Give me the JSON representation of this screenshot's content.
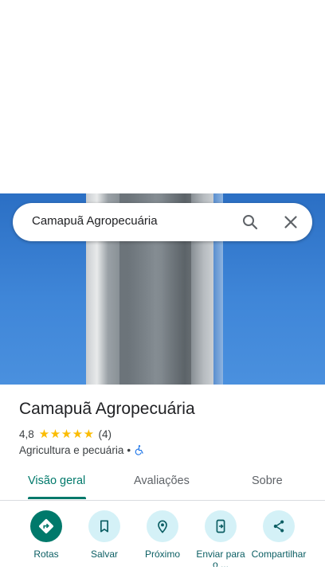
{
  "search": {
    "query": "Camapuã Agropecuária"
  },
  "place": {
    "name": "Camapuã Agropecuária",
    "rating": "4,8",
    "stars": [
      "★",
      "★",
      "★",
      "★",
      "★"
    ],
    "review_count": "(4)",
    "category": "Agricultura e pecuária",
    "separator": "•"
  },
  "tabs": [
    {
      "label": "Visão geral"
    },
    {
      "label": "Avaliações"
    },
    {
      "label": "Sobre"
    }
  ],
  "actions": [
    {
      "label": "Rotas",
      "icon": "directions-icon"
    },
    {
      "label": "Salvar",
      "icon": "bookmark-icon"
    },
    {
      "label": "Próximo",
      "icon": "nearby-icon"
    },
    {
      "label": "Enviar para o ...",
      "icon": "send-to-phone-icon"
    },
    {
      "label": "Compartilhar",
      "icon": "share-icon"
    }
  ],
  "colors": {
    "accent": "#00796b",
    "action_bg": "#d4f1f7",
    "star": "#fbbc04"
  }
}
